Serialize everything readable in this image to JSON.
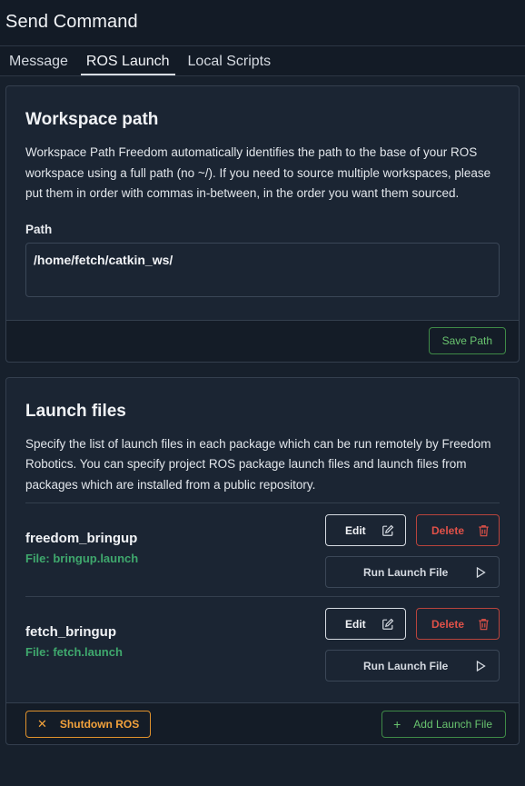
{
  "window": {
    "title": "Send Command"
  },
  "tabs": [
    {
      "label": "Message",
      "active": false
    },
    {
      "label": "ROS Launch",
      "active": true
    },
    {
      "label": "Local Scripts",
      "active": false
    }
  ],
  "workspace": {
    "heading": "Workspace path",
    "description": "Workspace Path Freedom automatically identifies the path to the base of your ROS workspace using a full path (no ~/). If you need to source multiple workspaces, please put them in order with commas in-between, in the order you want them sourced.",
    "path_label": "Path",
    "path_value": "/home/fetch/catkin_ws/",
    "save_label": "Save Path"
  },
  "launch": {
    "heading": "Launch files",
    "description": "Specify the list of launch files in each package which can be run remotely by Freedom Robotics. You can specify project ROS package launch files and launch files from packages which are installed from a public repository.",
    "items": [
      {
        "name": "freedom_bringup",
        "file": "File: bringup.launch"
      },
      {
        "name": "fetch_bringup",
        "file": "File: fetch.launch"
      }
    ],
    "edit_label": "Edit",
    "delete_label": "Delete",
    "run_label": "Run Launch File",
    "shutdown_label": "Shutdown ROS",
    "add_label": "Add Launch File"
  },
  "colors": {
    "background": "#17202c",
    "card": "#1b2533",
    "accent_green": "#69c46f",
    "file_green": "#3fa86d",
    "danger": "#e05148",
    "warning": "#f2a23c"
  },
  "icons": {
    "edit": "pencil-square-icon",
    "delete": "trash-icon",
    "run": "play-icon",
    "shutdown": "close-icon",
    "add": "plus-icon"
  }
}
